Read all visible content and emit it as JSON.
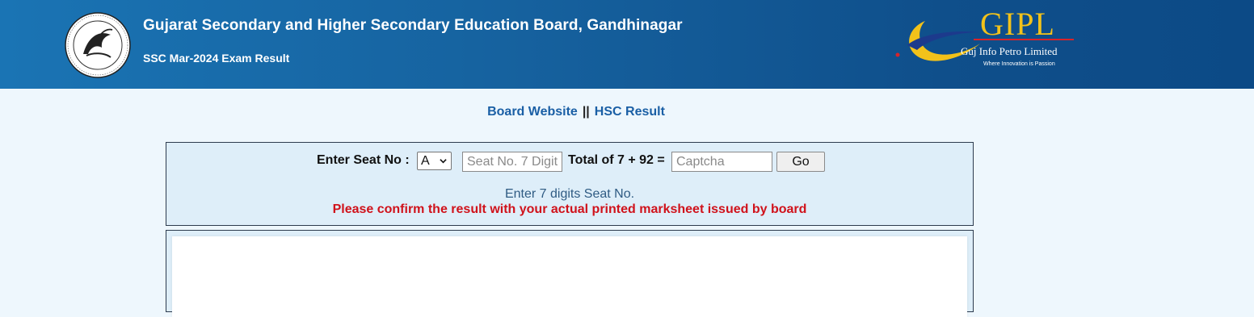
{
  "header": {
    "title": "Gujarat Secondary and Higher Secondary Education Board, Gandhinagar",
    "subtitle": "SSC Mar-2024 Exam Result",
    "emblem_icon": "board-emblem-icon",
    "partner_logo": {
      "name": "GIPL",
      "full_name": "Guj Info Petro Limited",
      "tagline": "Where Innovation is Passion"
    }
  },
  "nav": {
    "board_website": "Board Website",
    "separator": "||",
    "hsc_result": "HSC Result"
  },
  "form": {
    "seat_label": "Enter Seat No :",
    "seat_prefix_selected": "A",
    "seat_input_placeholder": "Seat No. 7 Digit",
    "seat_input_value": "",
    "captcha_label": "Total of 7 + 92 =",
    "captcha_placeholder": "Captcha",
    "captcha_value": "",
    "go_label": "Go",
    "hint": "Enter 7 digits Seat No.",
    "warning": "Please confirm the result with your actual printed marksheet issued by board"
  },
  "colors": {
    "header_bg": "#16629f",
    "link": "#1a5fa5",
    "warning": "#d0121b",
    "gipl_gold": "#f2c21a"
  }
}
